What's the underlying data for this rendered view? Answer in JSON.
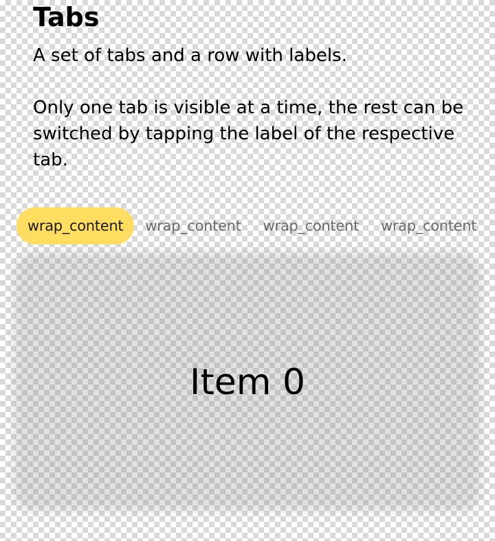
{
  "header": {
    "title": "Tabs",
    "description": "A set of tabs and a row with labels.\n\nOnly one tab is visible at a time, the rest can be switched by tapping the label of the respective tab."
  },
  "tabs": [
    {
      "label": "wrap_content",
      "active": true
    },
    {
      "label": "wrap_content",
      "active": false
    },
    {
      "label": "wrap_content",
      "active": false
    },
    {
      "label": "wrap_content",
      "active": false
    }
  ],
  "panel": {
    "label": "Item 0"
  },
  "colors": {
    "active_tab": "#ffdd60",
    "inactive_tab_text": "#6b6b6b"
  }
}
